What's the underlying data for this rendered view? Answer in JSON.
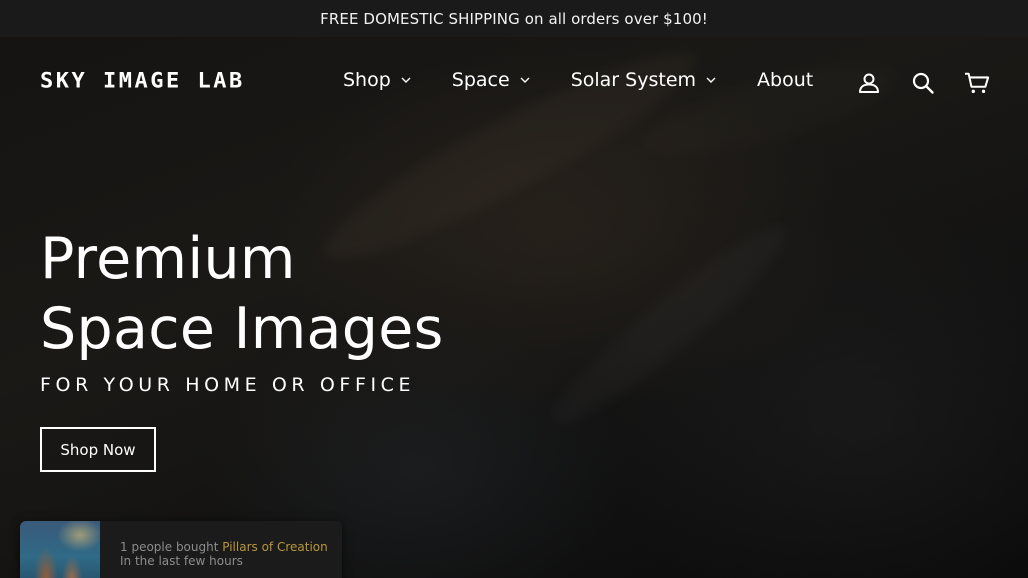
{
  "announcement": {
    "text": "FREE DOMESTIC SHIPPING on all orders over $100!"
  },
  "header": {
    "logo_text": "SKY IMAGE LAB",
    "nav": [
      {
        "label": "Shop",
        "has_dropdown": true
      },
      {
        "label": "Space",
        "has_dropdown": true
      },
      {
        "label": "Solar System",
        "has_dropdown": true
      },
      {
        "label": "About",
        "has_dropdown": false
      }
    ],
    "icons": [
      "account-icon",
      "search-icon",
      "cart-icon"
    ]
  },
  "hero": {
    "title_line1": "Premium",
    "title_line2": "Space Images",
    "subtitle": "FOR YOUR HOME OR OFFICE",
    "cta_label": "Shop Now"
  },
  "toast": {
    "prefix": "1 people bought ",
    "product": "Pillars of Creation",
    "time": "In the last few hours"
  },
  "colors": {
    "announcement_bg": "#1a1a1a",
    "text": "#ffffff",
    "toast_highlight": "#b8963a"
  }
}
